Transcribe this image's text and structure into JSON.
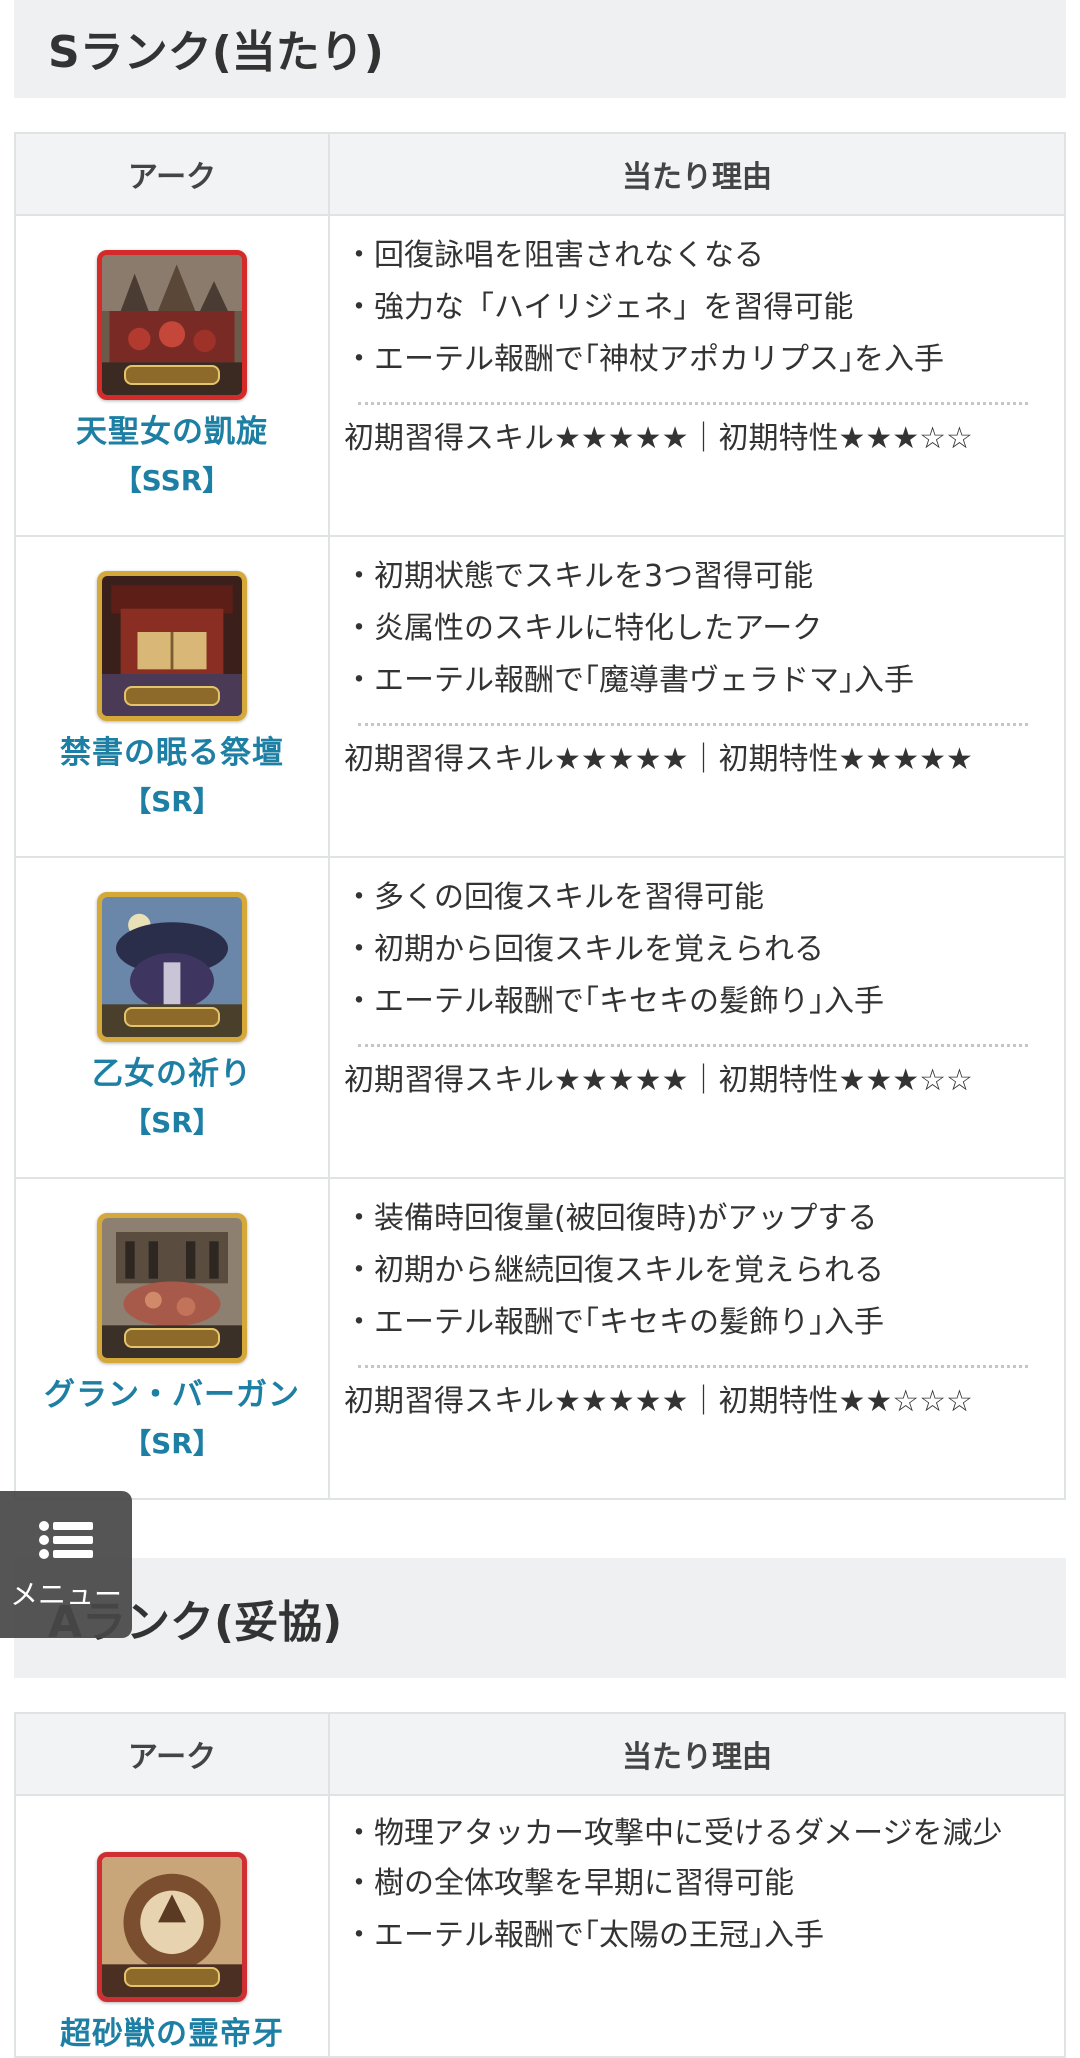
{
  "section_s": {
    "title": "Sランク(当たり)"
  },
  "section_a": {
    "title": "Aランク(妥協)"
  },
  "table_header": {
    "arc": "アーク",
    "reason": "当たり理由"
  },
  "s_rows": [
    {
      "name": "天聖女の凱旋",
      "rarity": "【SSR】",
      "reasons": [
        "・回復詠唱を阻害されなくなる",
        "・強力な「ハイリジェネ」を習得可能",
        "・エーテル報酬で｢神杖アポカリプス｣を入手"
      ],
      "rating": "初期習得スキル★★★★★｜初期特性★★★☆☆"
    },
    {
      "name": "禁書の眠る祭壇",
      "rarity": "【SR】",
      "reasons": [
        "・初期状態でスキルを3つ習得可能",
        "・炎属性のスキルに特化したアーク",
        "・エーテル報酬で｢魔導書ヴェラドマ｣入手"
      ],
      "rating": "初期習得スキル★★★★★｜初期特性★★★★★"
    },
    {
      "name": "乙女の祈り",
      "rarity": "【SR】",
      "reasons": [
        "・多くの回復スキルを習得可能",
        "・初期から回復スキルを覚えられる",
        "・エーテル報酬で｢キセキの髪飾り｣入手"
      ],
      "rating": "初期習得スキル★★★★★｜初期特性★★★☆☆"
    },
    {
      "name": "グラン・バーガン",
      "rarity": "【SR】",
      "reasons": [
        "・装備時回復量(被回復時)がアップする",
        "・初期から継続回復スキルを覚えられる",
        "・エーテル報酬で｢キセキの髪飾り｣入手"
      ],
      "rating": "初期習得スキル★★★★★｜初期特性★★☆☆☆"
    }
  ],
  "a_rows": [
    {
      "name": "超砂獣の霊帝牙",
      "reasons": [
        "・物理アタッカー攻撃中に受けるダメージを減少",
        "・樹の全体攻撃を早期に習得可能",
        "・エーテル報酬で｢太陽の王冠｣入手"
      ]
    }
  ],
  "menu": {
    "label": "メニュー",
    "icon": "list-icon"
  },
  "colors": {
    "link": "#1d7fa3",
    "header_bg": "#eef0f1",
    "border": "#dfe3e4"
  }
}
